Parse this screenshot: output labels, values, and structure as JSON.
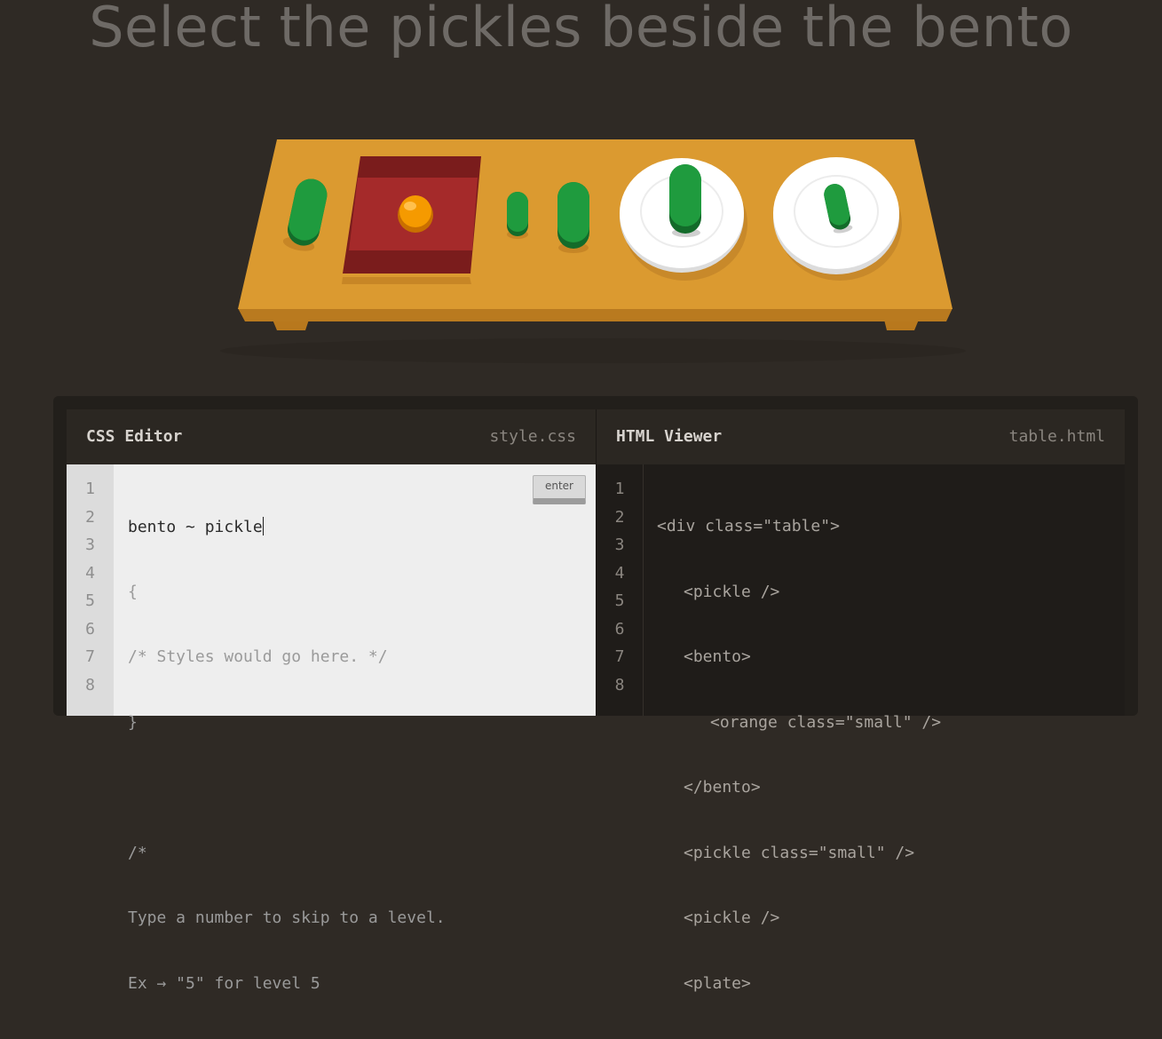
{
  "level_instruction": "Select the pickles beside the bento",
  "css_editor": {
    "title": "CSS Editor",
    "filename": "style.css",
    "enter_label": "enter",
    "line_numbers": [
      "1",
      "2",
      "3",
      "4",
      "5",
      "6",
      "7",
      "8"
    ],
    "input_value": "bento ~ pickle",
    "lines": [
      "{",
      "/* Styles would go here. */",
      "}",
      "",
      "/*",
      "Type a number to skip to a level.",
      "Ex → \"5\" for level 5"
    ]
  },
  "html_viewer": {
    "title": "HTML Viewer",
    "filename": "table.html",
    "line_numbers": [
      "1",
      "2",
      "3",
      "4",
      "5",
      "6",
      "7",
      "8"
    ],
    "lines": [
      "<div class=\"table\">",
      "<pickle />",
      "<bento>",
      "<orange class=\"small\" />",
      "</bento>",
      "<pickle class=\"small\" />",
      "<pickle />",
      "<plate>"
    ]
  },
  "scene": {
    "table_color": "#d8972d",
    "bento_color": "#a52a2a",
    "pickle_color": "#1f9b3e",
    "orange_color": "#f59a00",
    "plate_color": "#ffffff"
  }
}
